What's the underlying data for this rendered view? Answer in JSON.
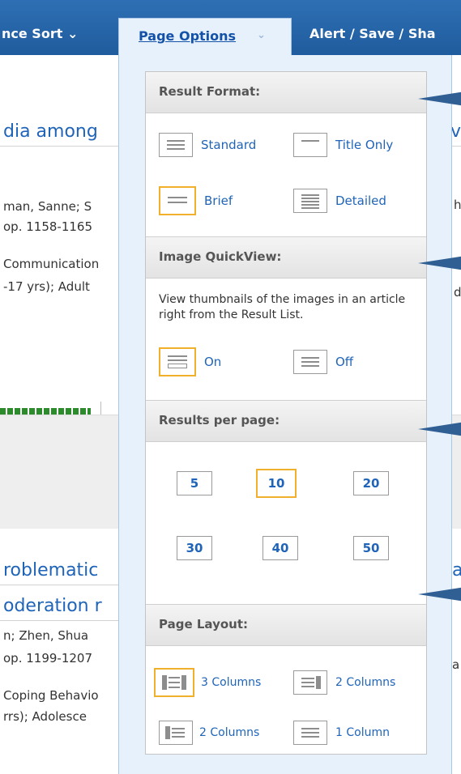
{
  "toolbar": {
    "sort_label": "nce Sort",
    "page_options_label": "Page Options",
    "alert_label": "Alert / Save / Sha"
  },
  "background": {
    "result1_title": "dia among",
    "result1_title_right": "ve",
    "result1_authors": "man, Sanne; S",
    "result1_pages": "op. 1158-1165",
    "result1_subject1": "Communication",
    "result1_subject2": "-17 yrs); Adult",
    "result1_right_a": "h",
    "result1_right_b": "d",
    "result2_title_a": "roblematic",
    "result2_title_b": "oderation r",
    "result2_title_right": "a",
    "result2_authors": "n; Zhen, Shua",
    "result2_pages": "op. 1199-1207",
    "result2_subject1": "Coping Behavio",
    "result2_subject2": "rrs); Adolesce",
    "result2_right": "a"
  },
  "panel": {
    "result_format": {
      "heading": "Result Format:",
      "options": [
        {
          "label": "Standard",
          "icon": "standard-format-icon",
          "selected": false
        },
        {
          "label": "Title Only",
          "icon": "title-only-format-icon",
          "selected": false
        },
        {
          "label": "Brief",
          "icon": "brief-format-icon",
          "selected": true
        },
        {
          "label": "Detailed",
          "icon": "detailed-format-icon",
          "selected": false
        }
      ]
    },
    "image_quickview": {
      "heading": "Image QuickView:",
      "description": "View thumbnails of the images in an article right from the Result List.",
      "on_label": "On",
      "off_label": "Off",
      "selected": "On"
    },
    "results_per_page": {
      "heading": "Results per page:",
      "options": [
        "5",
        "10",
        "20",
        "30",
        "40",
        "50"
      ],
      "selected": "10"
    },
    "page_layout": {
      "heading": "Page Layout:",
      "options": [
        {
          "label": "3 Columns",
          "selected": true
        },
        {
          "label": "2 Columns",
          "selected": false
        },
        {
          "label": "2 Columns",
          "selected": false
        },
        {
          "label": "1 Column",
          "selected": false
        }
      ]
    }
  },
  "colors": {
    "toolbar": "#1f5c9e",
    "panel_bg": "#e7f1fb",
    "link": "#1f64b8",
    "selected_border": "#f1b02b",
    "arrow": "#2f5f93"
  }
}
